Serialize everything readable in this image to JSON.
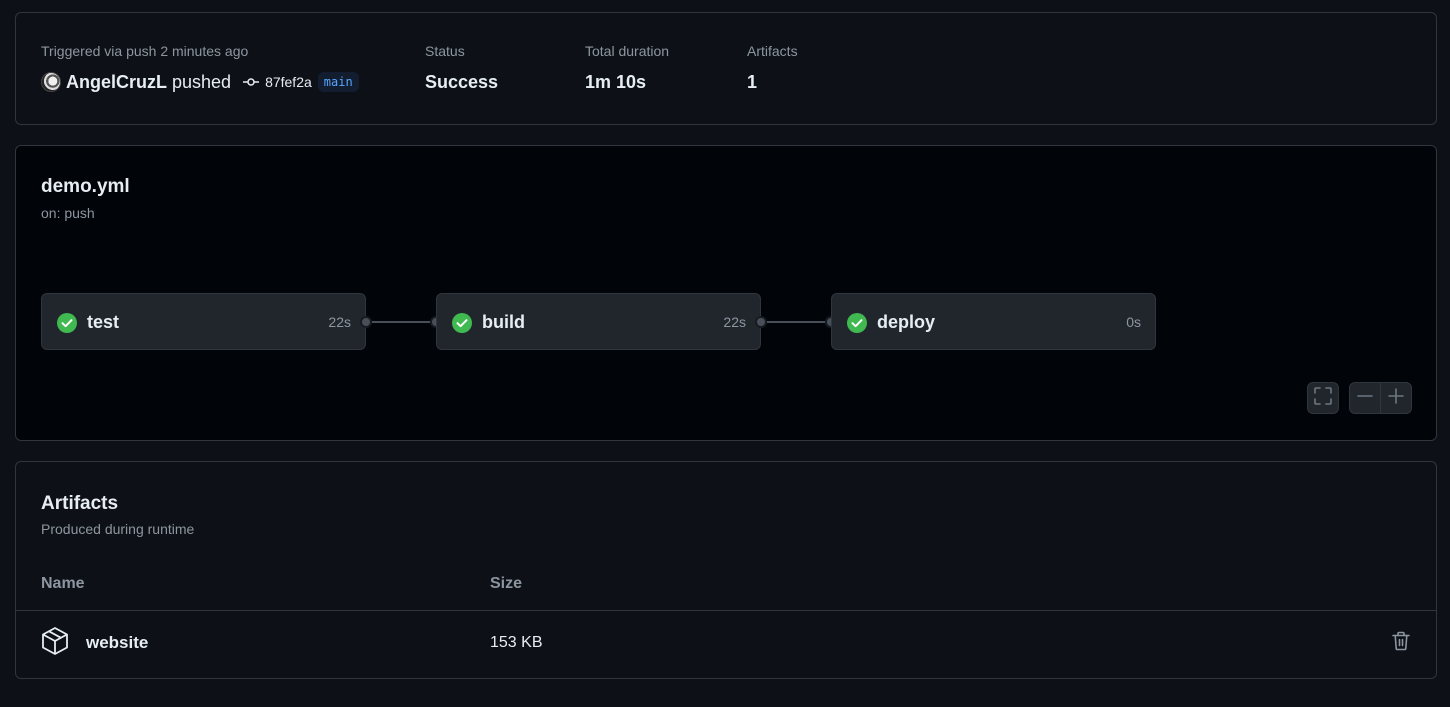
{
  "summary": {
    "trigger_label": "Triggered via push 2 minutes ago",
    "actor": "AngelCruzL",
    "action": "pushed",
    "commit_sha": "87fef2a",
    "branch": "main",
    "status_label": "Status",
    "status_value": "Success",
    "duration_label": "Total duration",
    "duration_value": "1m 10s",
    "artifacts_label": "Artifacts",
    "artifacts_value": "1"
  },
  "graph": {
    "title": "demo.yml",
    "subtitle": "on: push",
    "jobs": [
      {
        "name": "test",
        "duration": "22s",
        "status": "success"
      },
      {
        "name": "build",
        "duration": "22s",
        "status": "success"
      },
      {
        "name": "deploy",
        "duration": "0s",
        "status": "success"
      }
    ],
    "controls": {
      "fullscreen_icon": "fullscreen-icon",
      "zoom_out_icon": "minus-icon",
      "zoom_in_icon": "plus-icon"
    }
  },
  "artifacts": {
    "title": "Artifacts",
    "subtitle": "Produced during runtime",
    "columns": [
      "Name",
      "Size"
    ],
    "rows": [
      {
        "name": "website",
        "size": "153 KB",
        "icon": "package-icon"
      }
    ]
  },
  "colors": {
    "success": "#3fb950",
    "accent": "#58a6ff",
    "background": "#0d1117"
  }
}
